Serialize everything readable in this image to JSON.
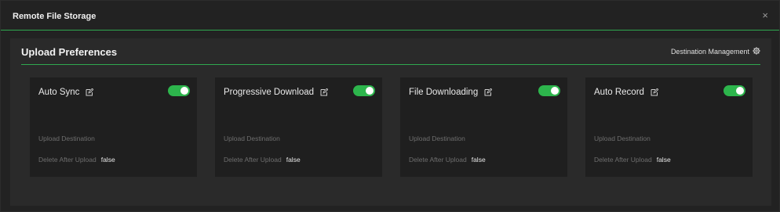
{
  "window": {
    "title": "Remote File Storage",
    "close_glyph": "×"
  },
  "panel": {
    "title": "Upload Preferences",
    "destination_management_label": "Destination Management",
    "destination_management_icon": "gear-icon"
  },
  "colors": {
    "accent": "#2fa84f",
    "toggle_on": "#2db54c"
  },
  "cards": [
    {
      "title": "Auto Sync",
      "enabled": true,
      "upload_destination_label": "Upload Destination",
      "delete_after_upload_label": "Delete After Upload",
      "delete_after_upload_value": "false"
    },
    {
      "title": "Progressive Download",
      "enabled": true,
      "upload_destination_label": "Upload Destination",
      "delete_after_upload_label": "Delete After Upload",
      "delete_after_upload_value": "false"
    },
    {
      "title": "File Downloading",
      "enabled": true,
      "upload_destination_label": "Upload Destination",
      "delete_after_upload_label": "Delete After Upload",
      "delete_after_upload_value": "false"
    },
    {
      "title": "Auto Record",
      "enabled": true,
      "upload_destination_label": "Upload Destination",
      "delete_after_upload_label": "Delete After Upload",
      "delete_after_upload_value": "false"
    }
  ]
}
